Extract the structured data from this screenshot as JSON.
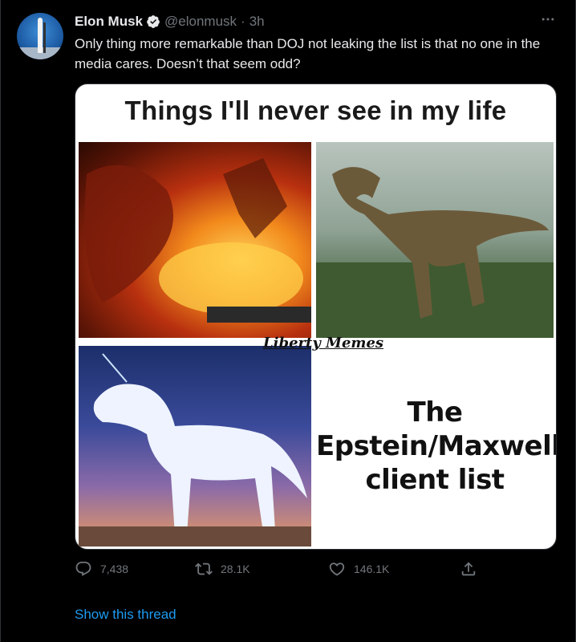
{
  "author": {
    "name": "Elon Musk",
    "handle": "@elonmusk",
    "separator": "·",
    "time": "3h",
    "verified": true
  },
  "tweet_text": "Only thing more remarkable than DOJ not leaking the list is that no one in the media cares. Doesn’t that seem odd?",
  "media": {
    "title": "Things I'll never see in my life",
    "watermark": "Liberty Memes",
    "caption_line1": "The",
    "caption_line2": "Epstein/Maxwell",
    "caption_line3": "client list"
  },
  "actions": {
    "replies": "7,438",
    "retweets": "28.1K",
    "likes": "146.1K"
  },
  "show_thread": "Show this thread",
  "icons": [
    "verified-icon",
    "more-icon",
    "reply-icon",
    "retweet-icon",
    "like-icon",
    "share-icon"
  ],
  "colors": {
    "accent": "#1d9bf0",
    "muted": "#71767b",
    "background": "#000000"
  }
}
